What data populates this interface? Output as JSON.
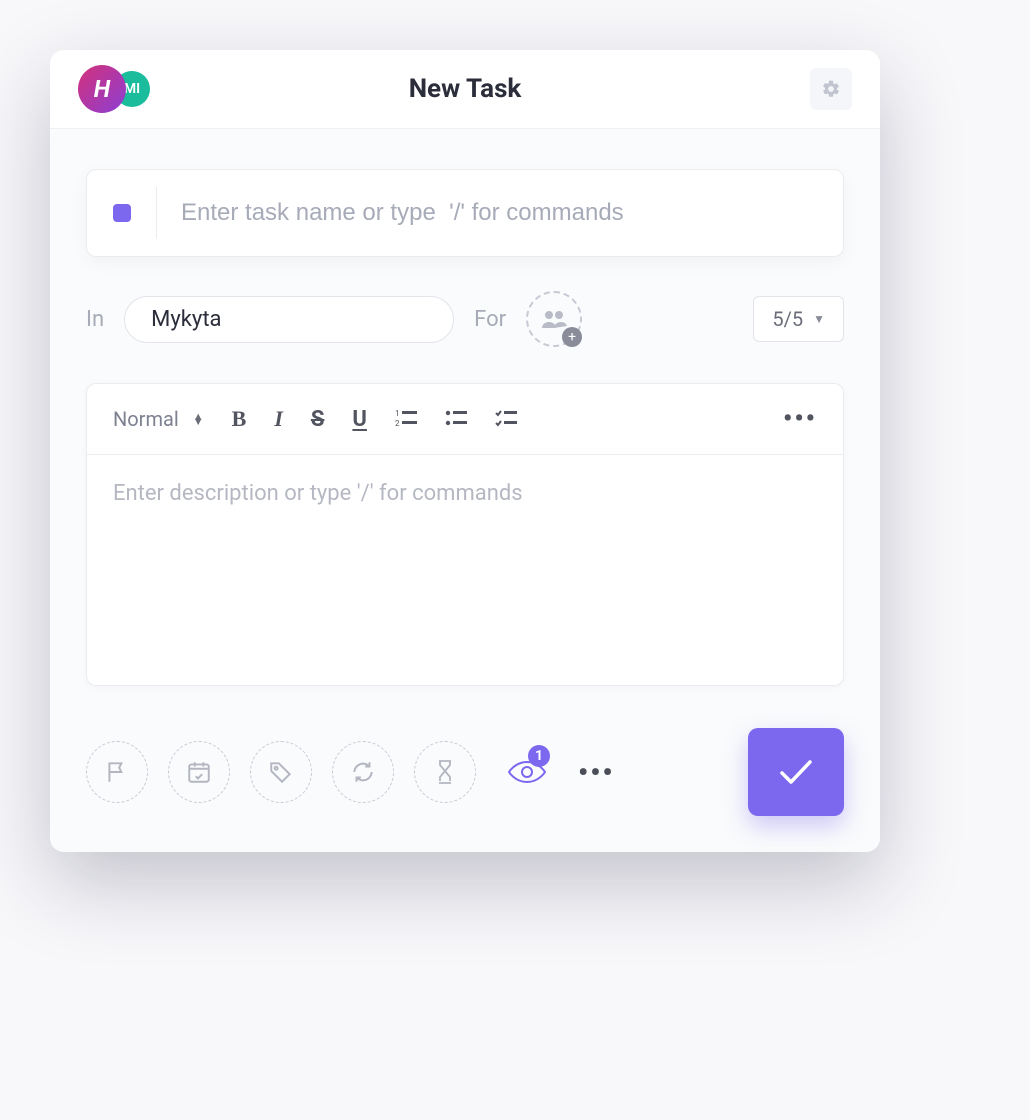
{
  "header": {
    "title": "New Task",
    "primary_avatar": "H",
    "secondary_avatar": "MI"
  },
  "task": {
    "name_placeholder": "Enter task name or type  '/' for commands",
    "in_label": "In",
    "list_value": "Mykyta",
    "for_label": "For",
    "priority_label": "5/5"
  },
  "editor": {
    "format_label": "Normal",
    "description_placeholder": "Enter description or type '/' for commands"
  },
  "watchers": {
    "count": "1"
  }
}
